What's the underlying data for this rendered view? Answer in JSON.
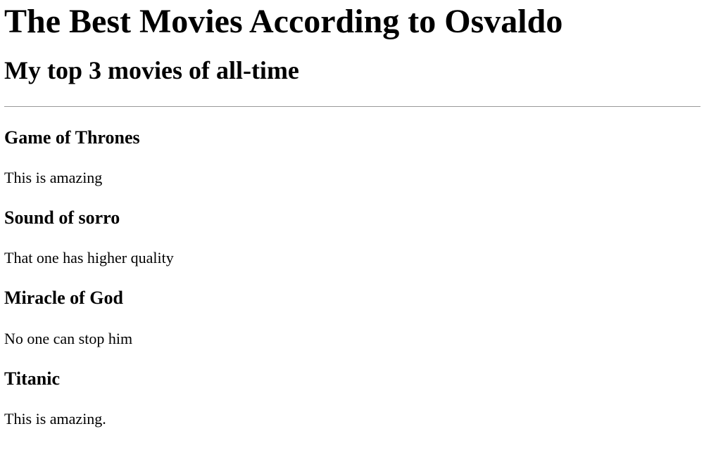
{
  "page": {
    "title": "The Best Movies According to Osvaldo",
    "subtitle": "My top 3 movies of all-time"
  },
  "movies": [
    {
      "title": "Game of Thrones",
      "description": "This is amazing"
    },
    {
      "title": "Sound of sorro",
      "description": "That one has higher quality"
    },
    {
      "title": "Miracle of God",
      "description": "No one can stop him"
    },
    {
      "title": "Titanic",
      "description": "This is amazing."
    }
  ]
}
